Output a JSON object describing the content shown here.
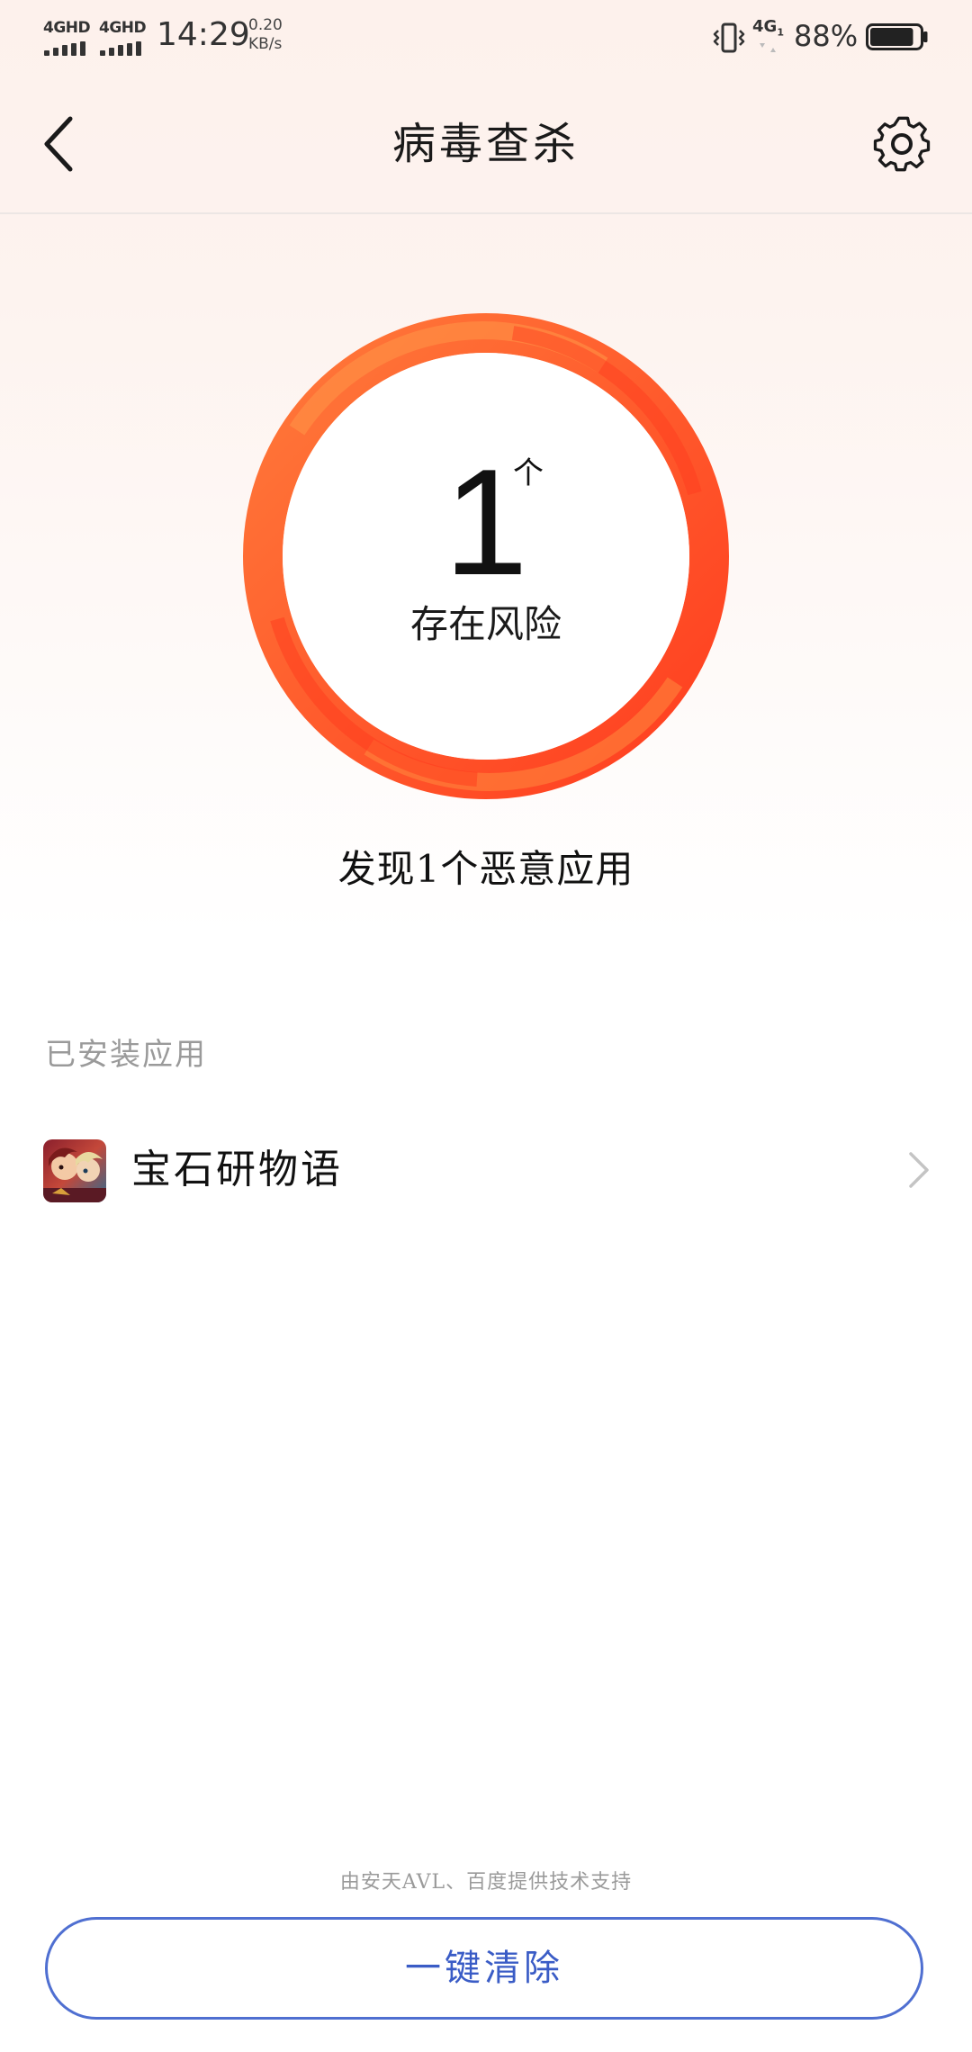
{
  "status_bar": {
    "sim1_label": "4GHD",
    "sim2_label": "4GHD",
    "time": "14:29",
    "net_speed_value": "0.20",
    "net_speed_unit": "KB/s",
    "network_label": "4G",
    "network_sub": "1",
    "battery_percent": "88%",
    "battery_level": 0.88,
    "icons": [
      "signal-icon",
      "signal-icon",
      "vibrate-icon",
      "network-4g-icon",
      "battery-icon"
    ]
  },
  "header": {
    "title": "病毒查杀",
    "back_icon": "chevron-left-icon",
    "settings_icon": "gear-icon"
  },
  "risk": {
    "count": "1",
    "unit": "个",
    "caption": "存在风险",
    "summary": "发现1个恶意应用",
    "ring_color_primary": "#ff5a2a",
    "ring_color_secondary": "#ff8a3a"
  },
  "installed_apps": {
    "section_title": "已安装应用",
    "items": [
      {
        "name": "宝石研物语",
        "icon": "game-app-icon"
      }
    ]
  },
  "footer": {
    "credit": "由安天AVL、百度提供技术支持",
    "clean_button_label": "一键清除",
    "accent_color": "#3a5cc6"
  }
}
